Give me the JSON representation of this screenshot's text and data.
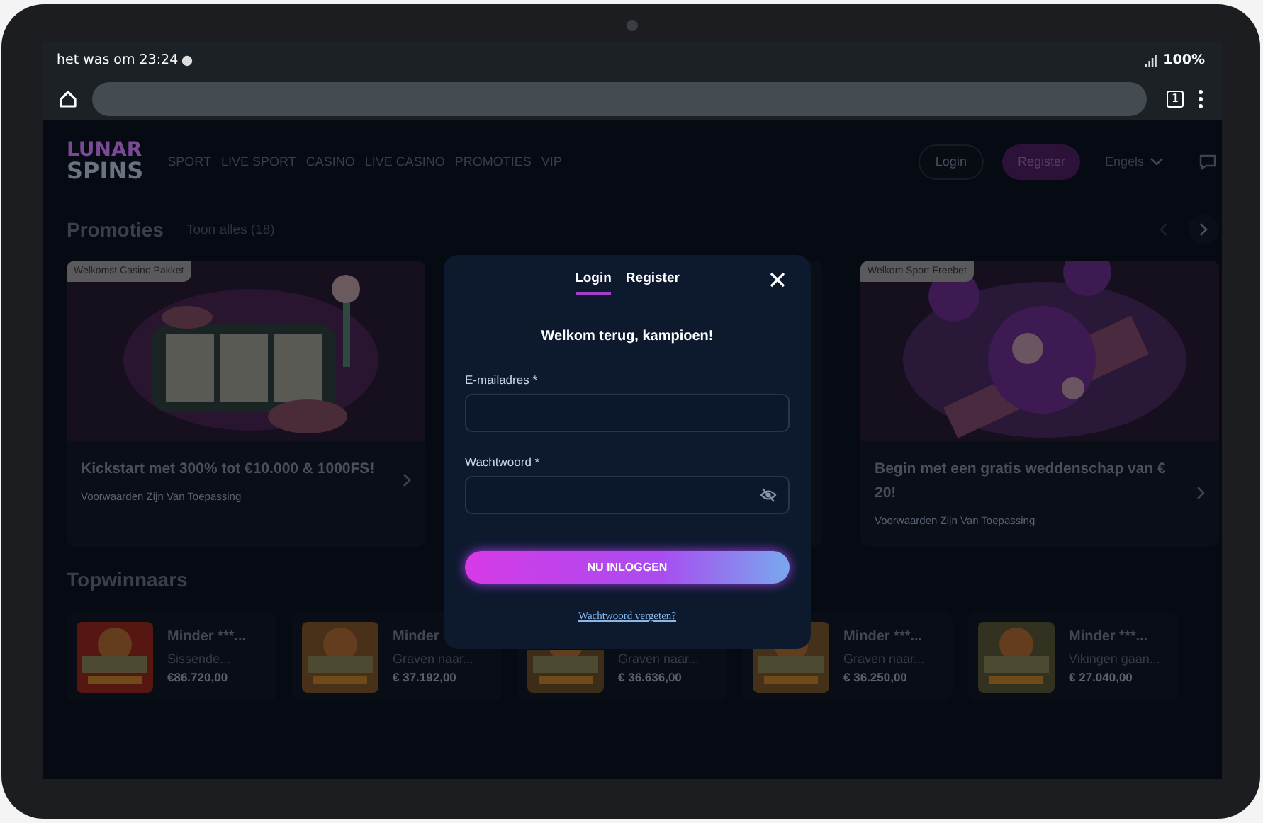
{
  "status_bar": {
    "time_text": "het was om 23:24",
    "battery": "100%"
  },
  "browser": {
    "tab_count": "1"
  },
  "header": {
    "logo_lines": [
      "LUNAR",
      "SPINS"
    ],
    "nav": [
      "SPORT",
      "LIVE SPORT",
      "CASINO",
      "LIVE CASINO",
      "PROMOTIES",
      "VIP"
    ],
    "login": "Login",
    "register": "Register",
    "language": "Engels"
  },
  "promotions": {
    "title": "Promoties",
    "show_all": "Toon alles (18)",
    "cards": [
      {
        "kind": "promo",
        "tag": "Welkomst Casino Pakket",
        "title": "Kickstart met 300% tot €10.000 & 1000FS!",
        "terms": "Voorwaarden Zijn Van Toepassing"
      },
      {
        "kind": "covered"
      },
      {
        "kind": "promo",
        "tag": "Welkom Sport Freebet",
        "title": "Begin met een gratis weddenschap van € 20!",
        "terms": "Voorwaarden Zijn Van Toepassing"
      }
    ]
  },
  "top_winners": {
    "title": "Topwinnaars",
    "cards": [
      {
        "title": "Minder ***...",
        "game": "Sissende...",
        "amount": "€86.720,00"
      },
      {
        "title": "Minder",
        "game": "Graven naar...",
        "amount": "€ 37.192,00"
      },
      {
        "game": "Graven naar...",
        "amount": "€ 36.636,00"
      },
      {
        "title": "Minder ***...",
        "game": "Graven naar...",
        "amount": "€ 36.250,00"
      },
      {
        "title": "Minder ***...",
        "game": "Vikingen gaan...",
        "amount": "€ 27.040,00"
      }
    ]
  },
  "login_dialog": {
    "tabs": [
      {
        "label": "Login",
        "selected": true
      },
      {
        "label": "Register",
        "selected": false
      }
    ],
    "heading": "Welkom terug, kampioen!",
    "fields": [
      {
        "label": "E-mailadres *",
        "kind": "text"
      },
      {
        "label": "Wachtwoord *",
        "kind": "password"
      }
    ],
    "submit": "NU INLOGGEN",
    "forgot": "Wachtwoord vergeten?"
  }
}
